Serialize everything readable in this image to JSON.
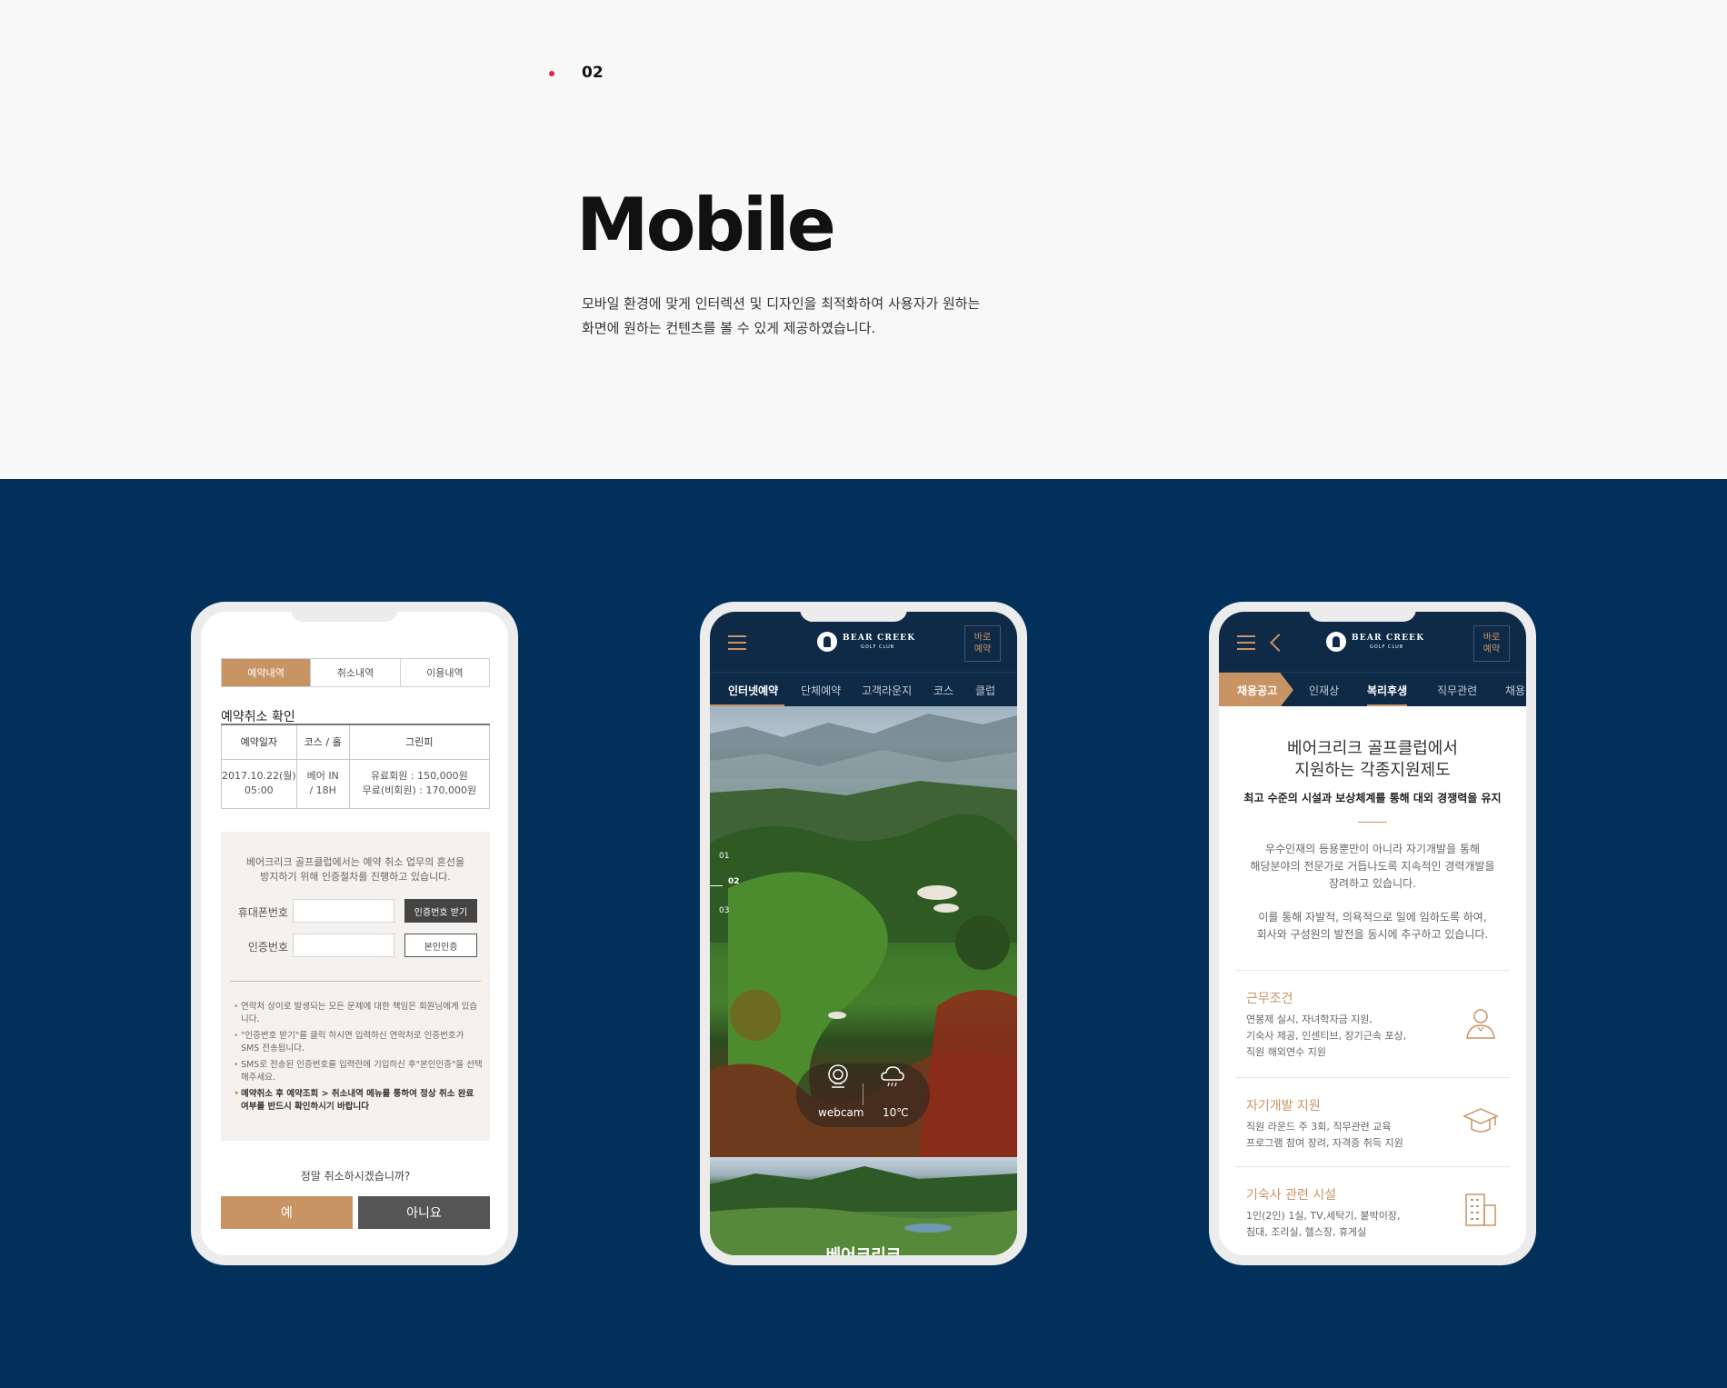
{
  "section": {
    "number": "02",
    "title": "Mobile",
    "desc": [
      "모바일 환경에 맞게 인터렉션 및 디자인을 최적화하여 사용자가 원하는",
      "화면에 원하는 컨텐츠를 볼 수 있게 제공하였습니다."
    ]
  },
  "colors": {
    "accent": "#c99464",
    "navy": "#02305a",
    "header_navy": "#0f2a47",
    "dot": "#e6204a"
  },
  "phone1": {
    "tabs": [
      "예약내역",
      "취소내역",
      "이용내역"
    ],
    "heading": "예약취소 확인",
    "table": {
      "headers": [
        "예약일자",
        "코스 / 홀",
        "그린피"
      ],
      "row": [
        "2017.10.22(월)",
        "05:00",
        "베어 IN",
        "/ 18H",
        "유료회원 : 150,000원",
        "무료(비회원) : 170,000원"
      ]
    },
    "intro": [
      "베어크리크 골프클럽에서는 예약 취소 업무의 혼선을",
      "방지하기 위해 인증절차를 진행하고 있습니다."
    ],
    "phone_label": "휴대폰번호",
    "phone_btn": "인증번호 받기",
    "code_label": "인증번호",
    "code_btn": "본인인증",
    "notes": [
      "연락처 상이로 발생되는 모든 문제에 대한 책임은 회원님에게 있습니다.",
      "\"인증번호 받기\"를 클릭 하시면 입력하신 연락처로 인증번호가 SMS 전송됩니다.",
      "SMS로 전송된 인증번호를 입력란에 기입하신 후\"본인인증\"을 선택해주세요.",
      "예약취소 후 예약조회 > 취소내역 메뉴를 통하여 정상 취소 완료 여부를 반드시 확인하시기 바랍니다"
    ],
    "question": "정말 취소하시겠습니까?",
    "yes": "예",
    "no": "아니요"
  },
  "header": {
    "logo_line1": "BEAR CREEK",
    "logo_line2": "GOLF CLUB",
    "quick_line1": "바로",
    "quick_line2": "예약"
  },
  "phone2": {
    "nav": [
      "인터넷예약",
      "단체예약",
      "고객라운지",
      "코스",
      "클럽"
    ],
    "pager": [
      "01",
      "02",
      "03"
    ],
    "webcam_label": "webcam",
    "temp": "10℃",
    "hero_text": "베어크리크"
  },
  "phone3": {
    "nav": [
      "채용공고",
      "인재상",
      "복리후생",
      "직무관련",
      "채용"
    ],
    "title": [
      "베어크리크 골프클럽에서",
      "지원하는 각종지원제도"
    ],
    "subtitle": "최고 수준의 시설과 보상체계를 통해 대외 경쟁력을 유지",
    "para1": [
      "우수인재의 등용뿐만이 아니라 자기개발을 통해",
      "해당분야의 전문가로 거듭나도록 지속적인 경력개발을",
      "장려하고 있습니다."
    ],
    "para2": [
      "이를 통해 자발적, 의욕적으로 일에 임하도록 하여,",
      "회사와 구성원의 발전을 동시에 추구하고 있습니다."
    ],
    "items": [
      {
        "title": "근무조건",
        "lines": [
          "연봉제 실시, 자녀학자금 지원,",
          "기숙사 제공, 인센티브, 장기근속 포상,",
          "직원 해외연수 지원"
        ],
        "icon": "person-icon"
      },
      {
        "title": "자기개발 지원",
        "lines": [
          "직원 라운드 주 3회, 직무관련 교육",
          "프로그램 참여 장려, 자격증 취득 지원"
        ],
        "icon": "graduation-cap-icon"
      },
      {
        "title": "기숙사 관련 시설",
        "lines": [
          "1인(2인) 1실, TV,세탁기, 붙박이장,",
          "침대, 조리실, 헬스장, 휴게실"
        ],
        "icon": "building-icon"
      }
    ]
  }
}
